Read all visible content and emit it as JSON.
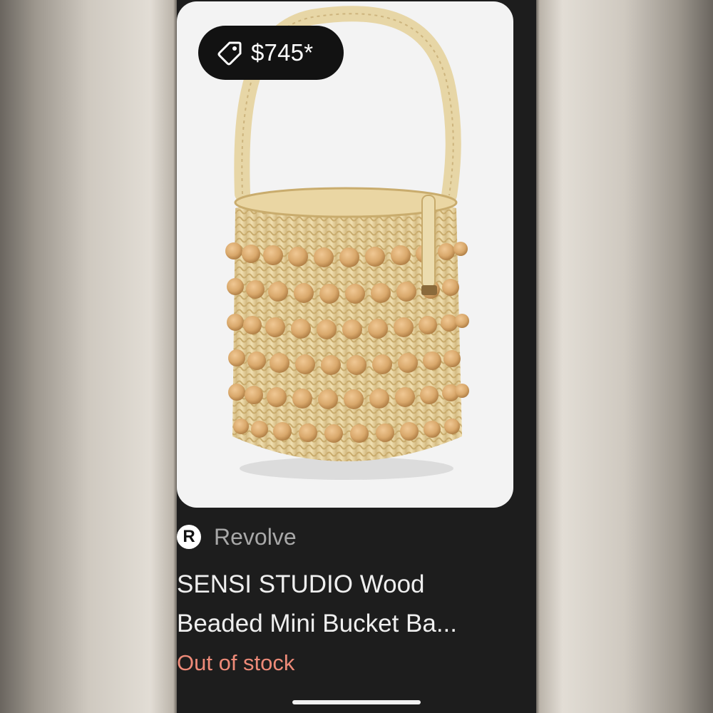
{
  "product": {
    "price": "$745*",
    "source_name": "Revolve",
    "source_logo_letter": "R",
    "title_line1": "SENSI STUDIO Wood",
    "title_line2": "Beaded Mini Bucket Ba...",
    "status": "Out of stock",
    "status_color": "#ed8a78",
    "image_subject": "woven raffia bucket bag with wooden beads"
  },
  "icons": {
    "price_tag": "price-tag-icon",
    "source_logo": "revolve-logo-icon"
  }
}
